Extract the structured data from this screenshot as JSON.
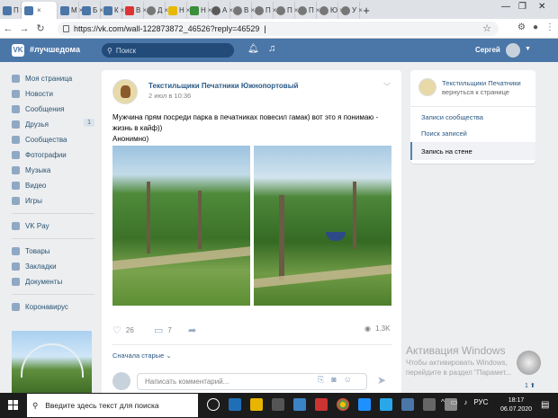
{
  "browser": {
    "tabs": [
      {
        "icon": "vk-icon",
        "label": "П",
        "active": false
      },
      {
        "icon": "vk-icon",
        "label": "",
        "active": true
      },
      {
        "icon": "vk-icon",
        "label": "М",
        "active": false
      },
      {
        "icon": "vk-icon",
        "label": "Б",
        "active": false
      },
      {
        "icon": "vk-icon",
        "label": "К",
        "active": false
      },
      {
        "icon": "red-site-icon",
        "label": "В",
        "active": false
      },
      {
        "icon": "globe-icon",
        "label": "Д",
        "active": false
      },
      {
        "icon": "yellow-site-icon",
        "label": "Н",
        "active": false
      },
      {
        "icon": "green-site-icon",
        "label": "Н",
        "active": false
      },
      {
        "icon": "arrow-site-icon",
        "label": "А",
        "active": false
      },
      {
        "icon": "globe-icon",
        "label": "В",
        "active": false
      },
      {
        "icon": "globe-icon",
        "label": "П",
        "active": false
      },
      {
        "icon": "globe-icon",
        "label": "П",
        "active": false
      },
      {
        "icon": "globe-icon",
        "label": "П",
        "active": false
      },
      {
        "icon": "globe-icon",
        "label": "Ю",
        "active": false
      },
      {
        "icon": "globe-icon",
        "label": "У",
        "active": false
      }
    ],
    "tab_close": "×",
    "new_tab": "+",
    "url": "https://vk.com/wall-122873872_46526?reply=46529"
  },
  "vk_header": {
    "logo": "VK",
    "hashtag": "#лучшедома",
    "search_placeholder": "Поиск",
    "user_name": "Сергей"
  },
  "left_menu": {
    "group1": [
      {
        "label": "Моя страница",
        "icon": "home-icon"
      },
      {
        "label": "Новости",
        "icon": "news-icon"
      },
      {
        "label": "Сообщения",
        "icon": "messages-icon"
      },
      {
        "label": "Друзья",
        "icon": "friends-icon",
        "count": "1"
      },
      {
        "label": "Сообщества",
        "icon": "communities-icon"
      },
      {
        "label": "Фотографии",
        "icon": "photos-icon"
      },
      {
        "label": "Музыка",
        "icon": "music-icon"
      },
      {
        "label": "Видео",
        "icon": "video-icon"
      },
      {
        "label": "Игры",
        "icon": "games-icon"
      }
    ],
    "group2": [
      {
        "label": "VK Pay",
        "icon": "vkpay-icon"
      }
    ],
    "group3": [
      {
        "label": "Товары",
        "icon": "goods-icon"
      },
      {
        "label": "Закладки",
        "icon": "bookmarks-icon"
      },
      {
        "label": "Документы",
        "icon": "documents-icon"
      }
    ],
    "group4": [
      {
        "label": "Коронавирус",
        "icon": "coronavirus-icon"
      }
    ]
  },
  "post": {
    "author": "Текстильщики Печатники Южнопортовый",
    "date": "2 июл в 10:36",
    "text_line1": "Мужчина прям посреди парка в печатниках повесил гамак) вот это я понимаю -",
    "text_line2": "жизнь в кайф))",
    "text_line3": "Анонимно)",
    "likes": "26",
    "comments": "7",
    "views": "1.3K",
    "sort_label": "Сначала старые",
    "comment_placeholder": "Написать комментарий..."
  },
  "right_panel": {
    "group_name": "Текстильщики Печатники",
    "back_link": "вернуться к странице",
    "items": [
      "Записи сообщества",
      "Поиск записей"
    ],
    "active_item": "Запись на стене"
  },
  "watermark": {
    "title": "Активация Windows",
    "text": "Чтобы активировать Windows, перейдите в раздел \"Парамет..."
  },
  "floating_badge": "1",
  "taskbar": {
    "search_placeholder": "Введите здесь текст для поиска",
    "language": "РУС",
    "time": "18:17",
    "date": "06.07.2020"
  },
  "colors": {
    "vk_blue": "#4a76a8",
    "link": "#2a5885",
    "background": "#edeef0"
  }
}
